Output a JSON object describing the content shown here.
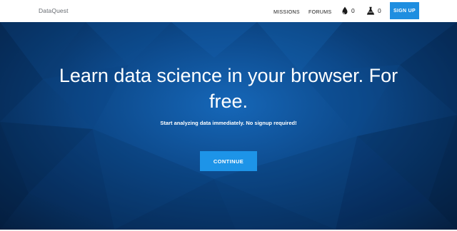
{
  "navbar": {
    "brand": "DataQuest",
    "links": [
      {
        "label": "MISSIONS"
      },
      {
        "label": "FORUMS"
      }
    ],
    "counters": [
      {
        "icon": "drops-icon",
        "value": "0"
      },
      {
        "icon": "flask-icon",
        "value": "0"
      }
    ],
    "signup_label": "SIGN UP"
  },
  "hero": {
    "title": "Learn data science in your browser. For free.",
    "subtitle": "Start analyzing data immediately. No signup required!",
    "cta_label": "CONTINUE"
  },
  "colors": {
    "accent": "#1e8ee0",
    "hero_dark": "#072f5e",
    "hero_light": "#1667b8"
  }
}
